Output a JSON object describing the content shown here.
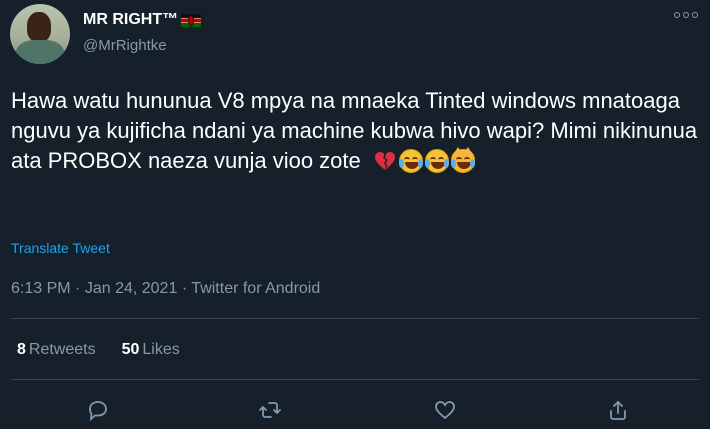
{
  "author": {
    "display_name": "MR RIGHT™",
    "handle": "@MrRightke",
    "flag_icon": "kenya-flag-icon"
  },
  "tweet": {
    "text": "Hawa watu hununua V8 mpya na mnaeka Tinted windows mnatoaga nguvu ya kujificha ndani ya machine kubwa hivo wapi? Mimi nikinunua ata PROBOX naeza vunja vioo zote",
    "emojis": [
      "broken-heart-icon",
      "tears-of-joy-icon",
      "tears-of-joy-icon",
      "cat-tears-of-joy-icon"
    ]
  },
  "translate_label": "Translate Tweet",
  "meta": {
    "time": "6:13 PM",
    "date": "Jan 24, 2021",
    "client": "Twitter for Android",
    "separator": "·"
  },
  "stats": {
    "retweets_count": "8",
    "retweets_label": "Retweets",
    "likes_count": "50",
    "likes_label": "Likes"
  },
  "actions": [
    "reply-icon",
    "retweet-icon",
    "like-icon",
    "share-icon"
  ],
  "colors": {
    "background": "#15202b",
    "accent": "#1da1f2",
    "secondary_text": "#8899a6",
    "divider": "#38444d"
  }
}
